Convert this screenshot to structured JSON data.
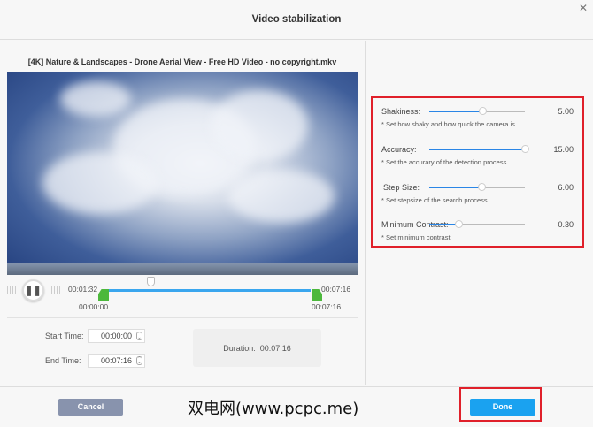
{
  "dialog": {
    "title": "Video stabilization",
    "close_icon": "close-icon"
  },
  "video": {
    "filename": "[4K] Nature & Landscapes - Drone Aerial View - Free HD Video - no copyright.mkv"
  },
  "player": {
    "current_time": "00:01:32",
    "range_start": "00:00:00",
    "range_end": "00:07:16",
    "end_label": "00:07:16",
    "play_state": "playing"
  },
  "trim": {
    "start_label": "Start Time:",
    "start_value": "00:00:00",
    "end_label": "End Time:",
    "end_value": "00:07:16",
    "duration_label": "Duration:",
    "duration_value": "00:07:16"
  },
  "settings": [
    {
      "name": "Shakiness:",
      "value": "5.00",
      "fraction": 0.56,
      "desc": "* Set how shaky and how quick the camera is."
    },
    {
      "name": "Accuracy:",
      "value": "15.00",
      "fraction": 1.0,
      "desc": "* Set the accurary of the detection process"
    },
    {
      "name": "Step Size:",
      "value": "6.00",
      "fraction": 0.55,
      "desc": "* Set stepsize of the search process"
    },
    {
      "name": "Minimum Contrast:",
      "value": "0.30",
      "fraction": 0.31,
      "desc": "* Set minimum contrast."
    }
  ],
  "footer": {
    "cancel": "Cancel",
    "done": "Done",
    "watermark": "双电网(www.pcpc.me)"
  },
  "colors": {
    "accent": "#1aa2f0",
    "highlight": "#e0202a",
    "handle": "#4cb83c"
  }
}
